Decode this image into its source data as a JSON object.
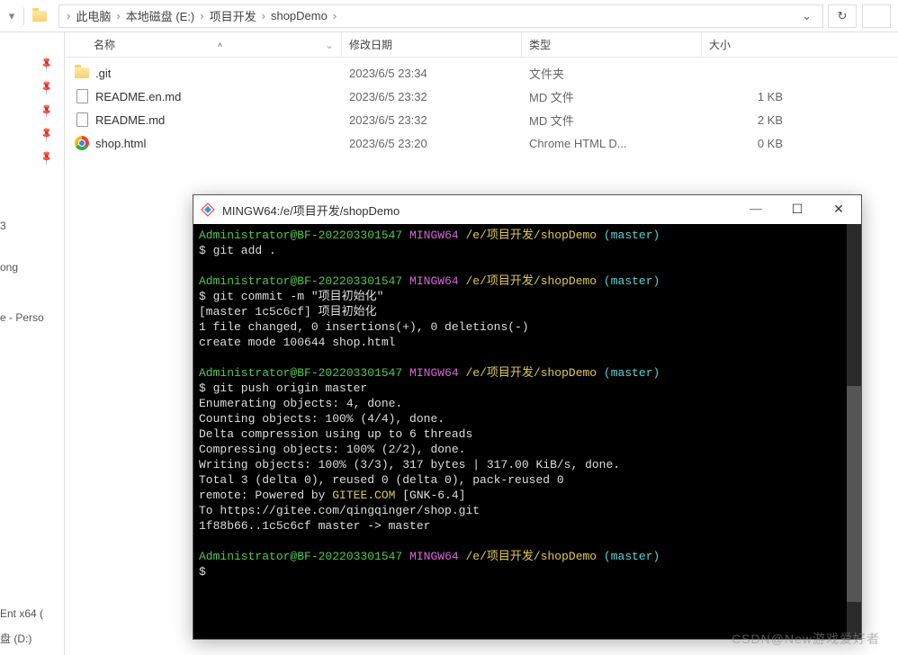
{
  "breadcrumb": {
    "items": [
      "此电脑",
      "本地磁盘 (E:)",
      "项目开发",
      "shopDemo"
    ]
  },
  "columns": {
    "name": "名称",
    "date": "修改日期",
    "type": "类型",
    "size": "大小"
  },
  "files": [
    {
      "icon": "folder",
      "name": ".git",
      "date": "2023/6/5 23:34",
      "type": "文件夹",
      "size": ""
    },
    {
      "icon": "file",
      "name": "README.en.md",
      "date": "2023/6/5 23:32",
      "type": "MD 文件",
      "size": "1 KB"
    },
    {
      "icon": "file",
      "name": "README.md",
      "date": "2023/6/5 23:32",
      "type": "MD 文件",
      "size": "2 KB"
    },
    {
      "icon": "chrome",
      "name": "shop.html",
      "date": "2023/6/5 23:20",
      "type": "Chrome HTML D...",
      "size": "0 KB"
    }
  ],
  "sidebar_labels": {
    "s1": "3",
    "s2": "ong",
    "s3": "e - Perso",
    "s4": " Ent x64 (",
    "s5": "盘 (D:)"
  },
  "terminal": {
    "title": "MINGW64:/e/项目开发/shopDemo",
    "prompt_user": "Administrator@BF-202203301547",
    "prompt_env": "MINGW64",
    "prompt_path": "/e/项目开发/shopDemo",
    "prompt_branch": "(master)",
    "lines": {
      "cmd1": "$ git add .",
      "cmd2": "$ git commit -m \"项目初始化\"",
      "out2a": "[master 1c5c6cf] 项目初始化",
      "out2b": " 1 file changed, 0 insertions(+), 0 deletions(-)",
      "out2c": " create mode 100644 shop.html",
      "cmd3": "$ git push origin master",
      "out3a": "Enumerating objects: 4, done.",
      "out3b": "Counting objects: 100% (4/4), done.",
      "out3c": "Delta compression using up to 6 threads",
      "out3d": "Compressing objects: 100% (2/2), done.",
      "out3e": "Writing objects: 100% (3/3), 317 bytes | 317.00 KiB/s, done.",
      "out3f": "Total 3 (delta 0), reused 0 (delta 0), pack-reused 0",
      "out3g_pre": "remote: Powered by ",
      "out3g_gitee": "GITEE.COM",
      "out3g_post": " [GNK-6.4]",
      "out3h": "To https://gitee.com/qingqinger/shop.git",
      "out3i": "   1f88b66..1c5c6cf  master -> master",
      "cmd4": "$"
    }
  },
  "watermark": "CSDN@New游戏爱好者"
}
